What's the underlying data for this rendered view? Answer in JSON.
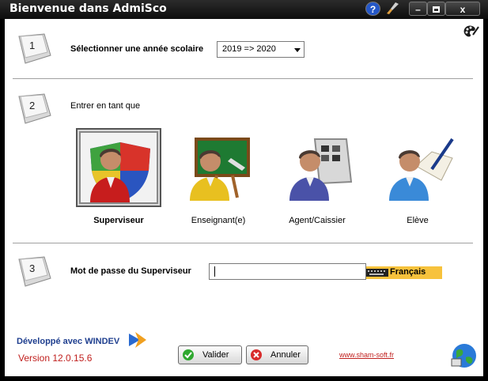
{
  "window": {
    "title": "Bienvenue dans AdmiSco"
  },
  "titlebar": {
    "help": "?",
    "minimize": "–",
    "close": "x"
  },
  "step1": {
    "number": "1",
    "label": "Sélectionner une année scolaire",
    "year_value": "2019 => 2020"
  },
  "step2": {
    "number": "2",
    "label": "Entrer en tant que",
    "roles": [
      {
        "label": "Superviseur"
      },
      {
        "label": "Enseignant(e)"
      },
      {
        "label": "Agent/Caissier"
      },
      {
        "label": "Elève"
      }
    ]
  },
  "step3": {
    "number": "3",
    "label": "Mot de passe du Superviseur",
    "password_value": "",
    "keyboard_lang": "Français"
  },
  "footer": {
    "dev_text": "Développé avec WINDEV",
    "version": "Version 12.0.15.6",
    "validate": "Valider",
    "cancel": "Annuler",
    "website": "www.sham-soft.fr"
  },
  "icons": [
    "help-icon",
    "brush-icon",
    "minimize-icon",
    "maximize-icon",
    "close-icon",
    "palette-icon",
    "supervisor-icon",
    "teacher-icon",
    "agent-icon",
    "student-icon",
    "keyboard-icon",
    "windev-logo-icon",
    "check-icon",
    "cancel-icon",
    "globe-icon"
  ],
  "colors": {
    "titlebar": "#111111",
    "accent_blue": "#1f3f8f",
    "version_red": "#c0201e",
    "keyboard_badge": "#f7c23c"
  }
}
